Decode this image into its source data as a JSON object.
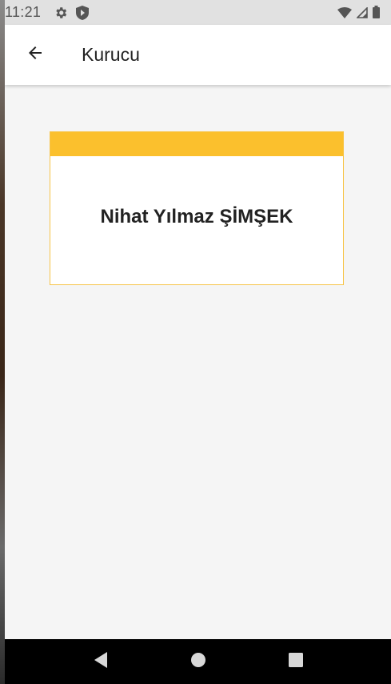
{
  "status_bar": {
    "time": "11:21",
    "icons": [
      "settings-gear-icon",
      "shield-icon",
      "wifi-icon",
      "signal-icon",
      "battery-icon"
    ]
  },
  "app_bar": {
    "title": "Kurucu",
    "back_icon": "arrow-back-icon"
  },
  "card": {
    "name": "Nihat Yılmaz ŞİMŞEK",
    "accent_color": "#fbc02d"
  },
  "nav_bar": {
    "buttons": [
      "back-triangle-icon",
      "home-circle-icon",
      "recents-square-icon"
    ]
  },
  "colors": {
    "background": "#f5f5f5",
    "status_bar": "#e1e1e1",
    "app_bar": "#ffffff",
    "nav_bar": "#000000"
  }
}
